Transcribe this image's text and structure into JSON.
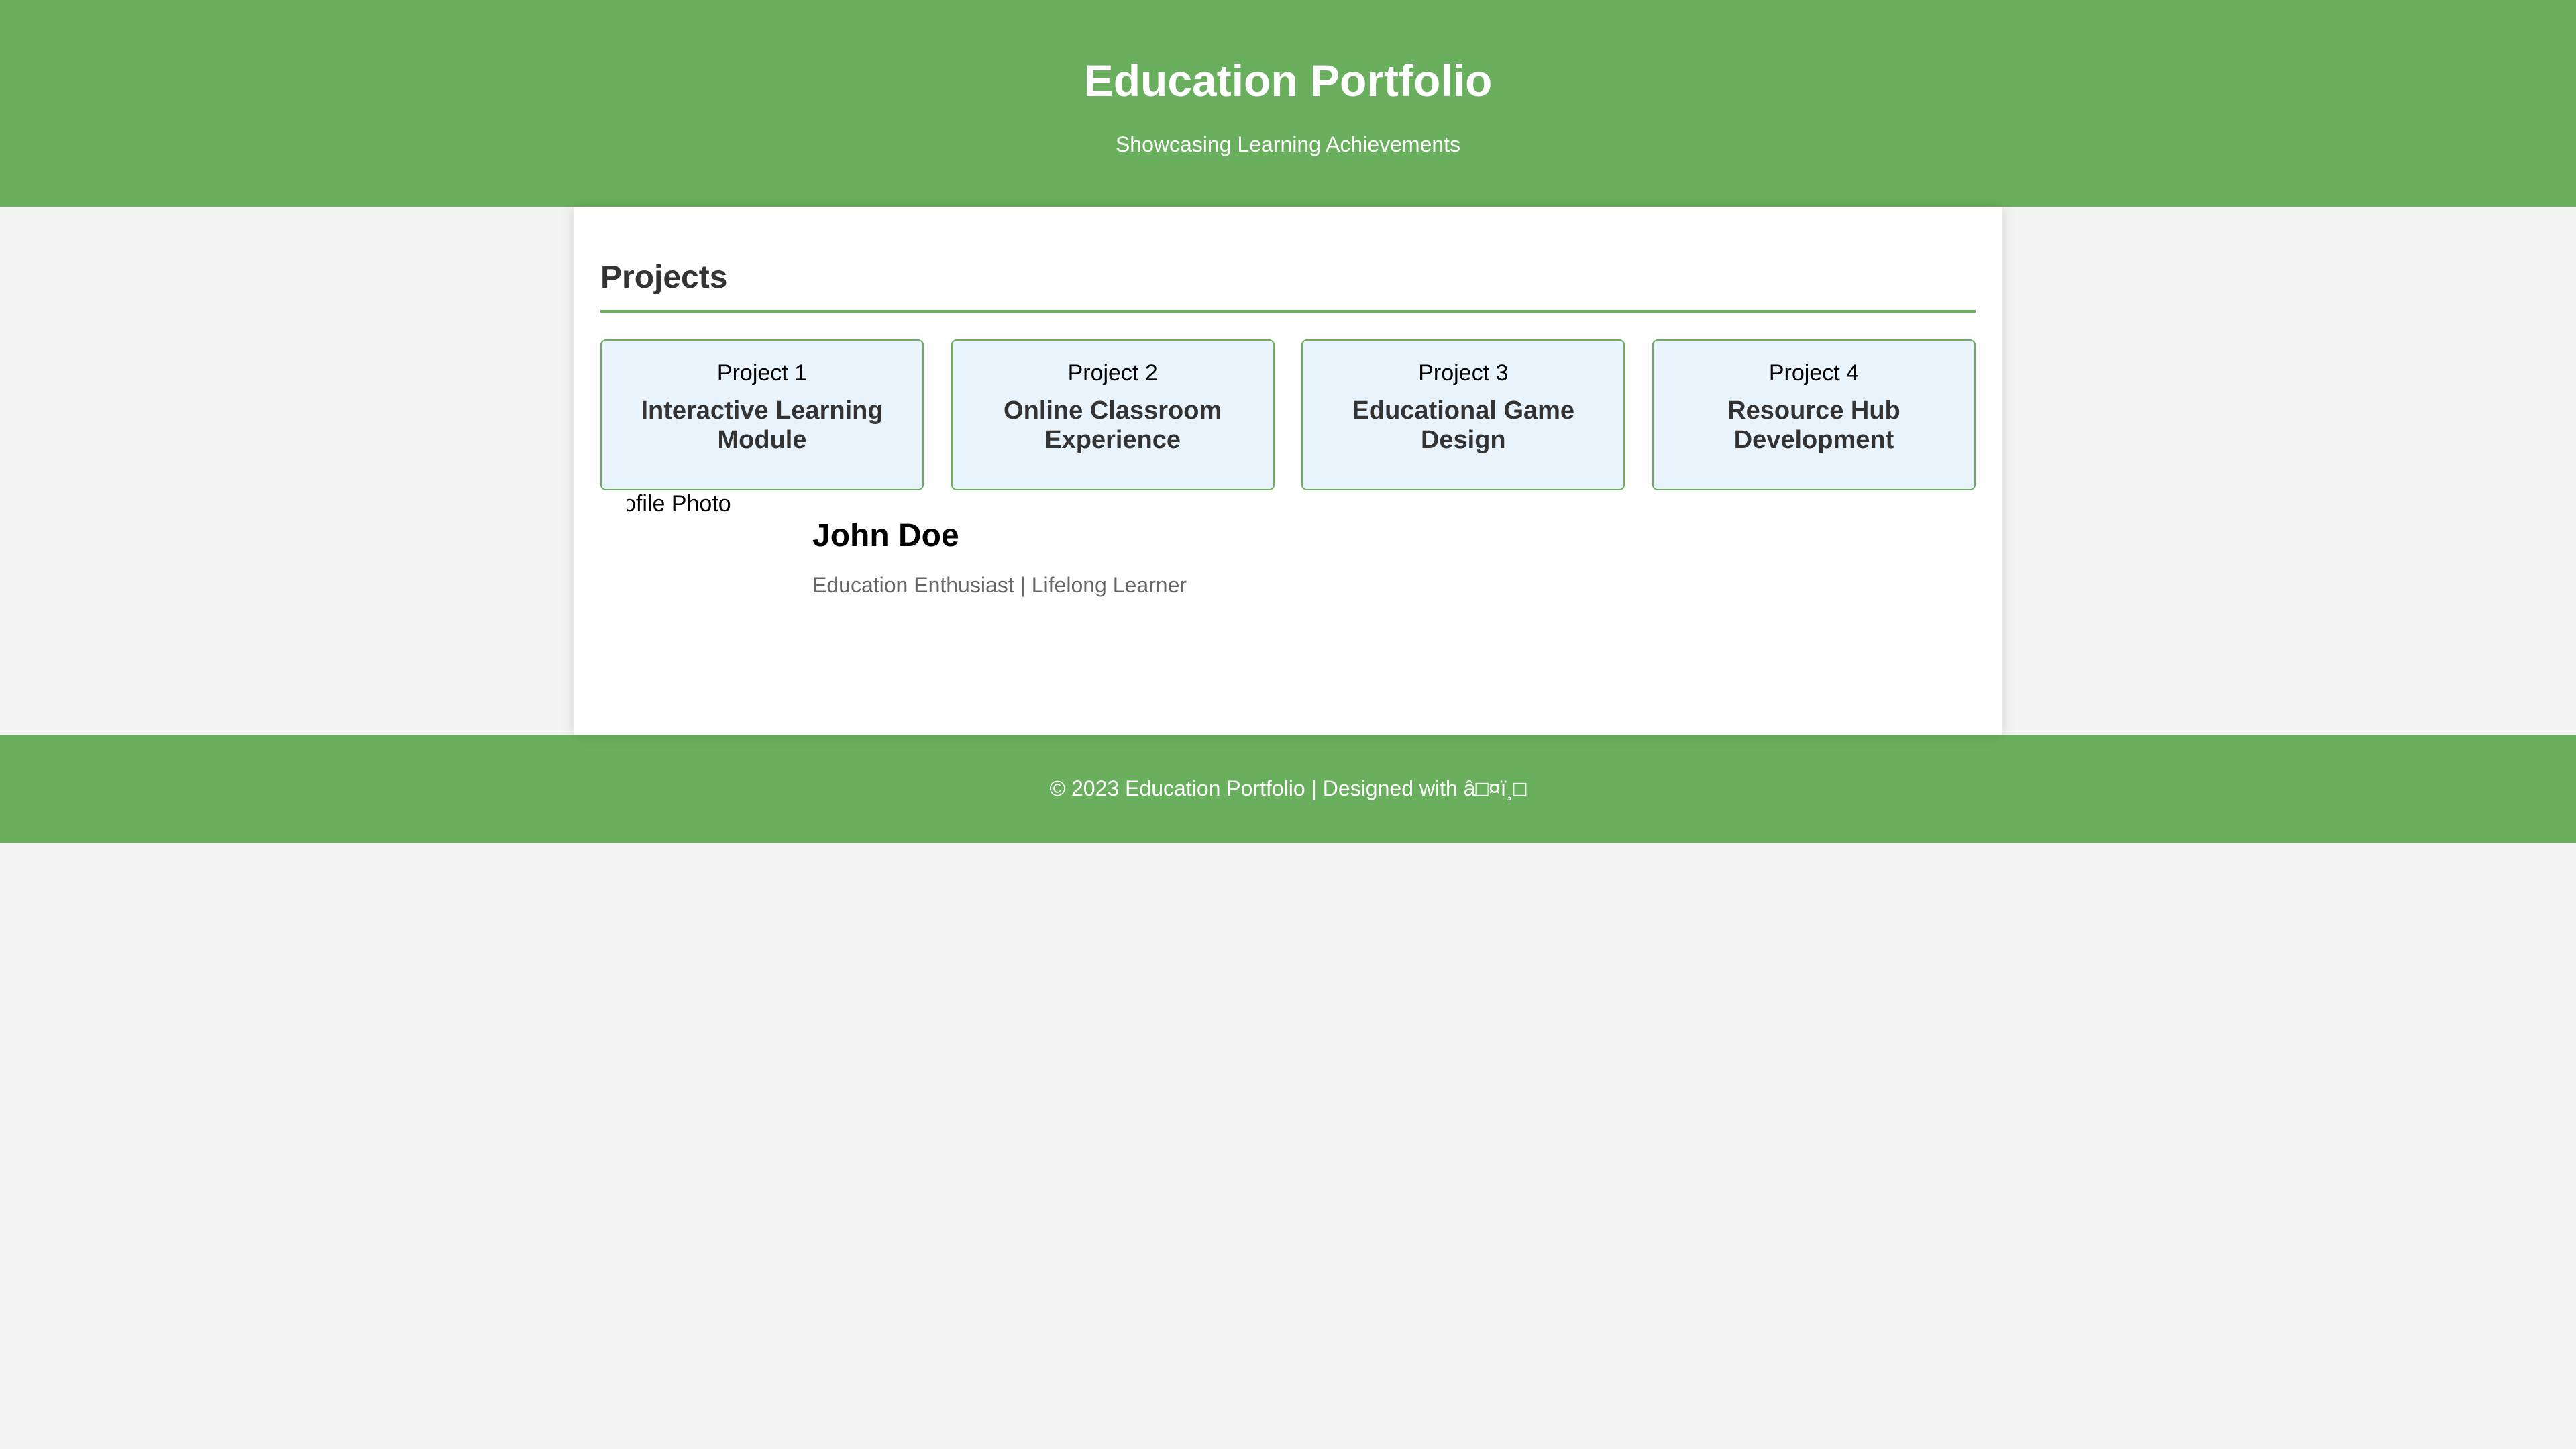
{
  "header": {
    "title": "Education Portfolio",
    "subtitle": "Showcasing Learning Achievements"
  },
  "projects_section": {
    "title": "Projects",
    "items": [
      {
        "image_alt": "Project 1",
        "title": "Interactive Learning Module"
      },
      {
        "image_alt": "Project 2",
        "title": "Online Classroom Experience"
      },
      {
        "image_alt": "Project 3",
        "title": "Educational Game Design"
      },
      {
        "image_alt": "Project 4",
        "title": "Resource Hub Development"
      }
    ]
  },
  "profile": {
    "photo_alt": "Profile Photo",
    "name": "John Doe",
    "tagline": "Education Enthusiast | Lifelong Learner"
  },
  "footer": {
    "text": "© 2023 Education Portfolio | Designed with â□¤ï¸□"
  },
  "colors": {
    "accent": "#6aaf5e",
    "page_background": "#f4f4f4",
    "card_background": "#e8f3fb",
    "heading_text": "#333333",
    "muted_text": "#666666"
  }
}
